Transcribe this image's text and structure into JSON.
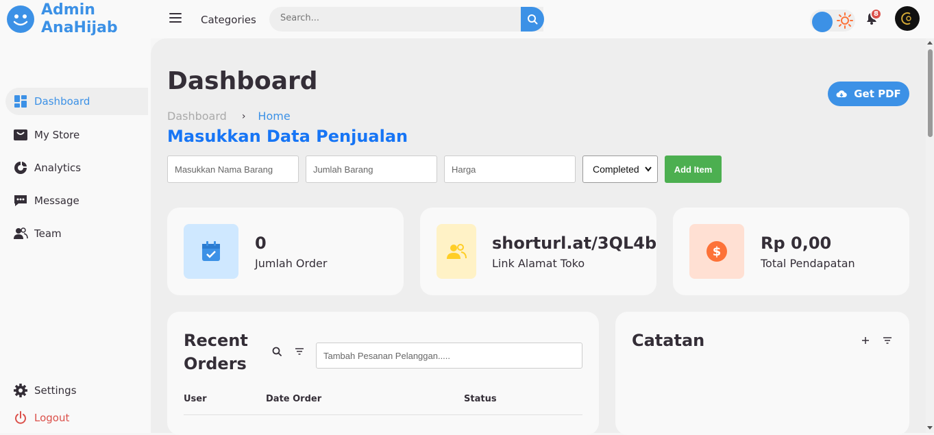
{
  "brand": {
    "line1": "Admin",
    "line2": "AnaHijab"
  },
  "topbar": {
    "categories_label": "Categories",
    "search_placeholder": "Search...",
    "notification_count": "8",
    "accent_color": "#3c91e6"
  },
  "sidebar": {
    "items": [
      {
        "label": "Dashboard",
        "icon": "dashboard-icon",
        "active": true
      },
      {
        "label": "My Store",
        "icon": "store-icon"
      },
      {
        "label": "Analytics",
        "icon": "analytics-icon"
      },
      {
        "label": "Message",
        "icon": "message-icon"
      },
      {
        "label": "Team",
        "icon": "team-icon"
      }
    ],
    "settings_label": "Settings",
    "logout_label": "Logout"
  },
  "main": {
    "title": "Dashboard",
    "breadcrumb": [
      "Dashboard",
      "Home"
    ],
    "get_pdf_label": "Get PDF",
    "form": {
      "title": "Masukkan Data Penjualan",
      "item_name_placeholder": "Masukkan Nama Barang",
      "quantity_placeholder": "Jumlah Barang",
      "price_placeholder": "Harga",
      "status_selected": "Completed",
      "add_button": "Add Item"
    },
    "cards": [
      {
        "value": "0",
        "label": "Jumlah Order",
        "icon": "calendar-check-icon"
      },
      {
        "value": "shorturl.at/3QL4b",
        "label": "Link Alamat Toko",
        "icon": "people-icon"
      },
      {
        "value": "Rp 0,00",
        "label": "Total Pendapatan",
        "icon": "dollar-circle-icon"
      }
    ],
    "recent_orders": {
      "title_line1": "Recent",
      "title_line2": "Orders",
      "search_placeholder": "Tambah Pesanan Pelanggan.....",
      "columns": [
        "User",
        "Date Order",
        "Status"
      ]
    },
    "notes": {
      "title": "Catatan"
    }
  }
}
